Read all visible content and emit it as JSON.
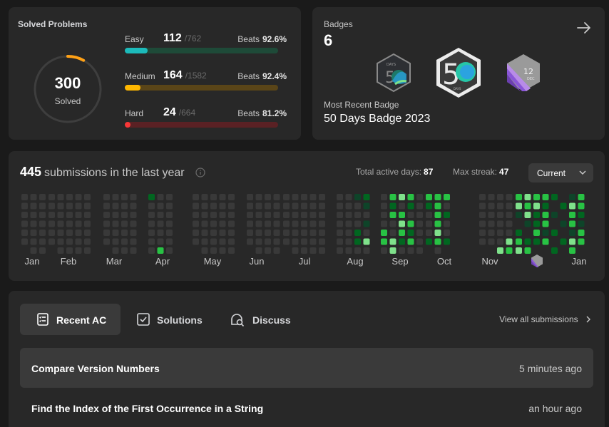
{
  "solved": {
    "title": "Solved Problems",
    "total": "300",
    "total_label": "Solved",
    "ring_fraction": 0.08,
    "difficulties": [
      {
        "name": "Easy",
        "count": "112",
        "total": "/762",
        "beats_label": "Beats",
        "beats": "92.6%",
        "fraction": 0.147,
        "color": "#1cbaba",
        "track": "#1e4a38"
      },
      {
        "name": "Medium",
        "count": "164",
        "total": "/1582",
        "beats_label": "Beats",
        "beats": "92.4%",
        "fraction": 0.104,
        "color": "#ffb700",
        "track": "#5a4518"
      },
      {
        "name": "Hard",
        "count": "24",
        "total": "/664",
        "beats_label": "Beats",
        "beats": "81.2%",
        "fraction": 0.036,
        "color": "#f63737",
        "track": "#5a2124"
      }
    ]
  },
  "badges": {
    "title": "Badges",
    "count": "6",
    "recent_label": "Most Recent Badge",
    "recent_name": "50 Days Badge 2023",
    "icons": [
      "50-days-small-badge-icon",
      "50-days-large-badge-icon",
      "dec-12-badge-icon"
    ]
  },
  "heatmap": {
    "count": "445",
    "title_text": "submissions in the last year",
    "active_days_label": "Total active days:",
    "active_days": "87",
    "max_streak_label": "Max streak:",
    "max_streak": "47",
    "range": "Current",
    "months": [
      "Jan",
      "Feb",
      "Mar",
      "Apr",
      "May",
      "Jun",
      "Jul",
      "Aug",
      "Sep",
      "Oct",
      "Nov",
      "Jan"
    ],
    "colors": {
      "empty": "#393939",
      "l1": "#0e4429",
      "l2": "#016620",
      "l3": "#28c244",
      "l4": "#7fe18b"
    }
  },
  "recent": {
    "tabs": [
      {
        "label": "Recent AC",
        "icon": "list-icon"
      },
      {
        "label": "Solutions",
        "icon": "checkbox-icon"
      },
      {
        "label": "Discuss",
        "icon": "discuss-icon"
      }
    ],
    "view_all": "View all submissions",
    "items": [
      {
        "title": "Compare Version Numbers",
        "time": "5 minutes ago"
      },
      {
        "title": "Find the Index of the First Occurrence in a String",
        "time": "an hour ago"
      }
    ]
  }
}
